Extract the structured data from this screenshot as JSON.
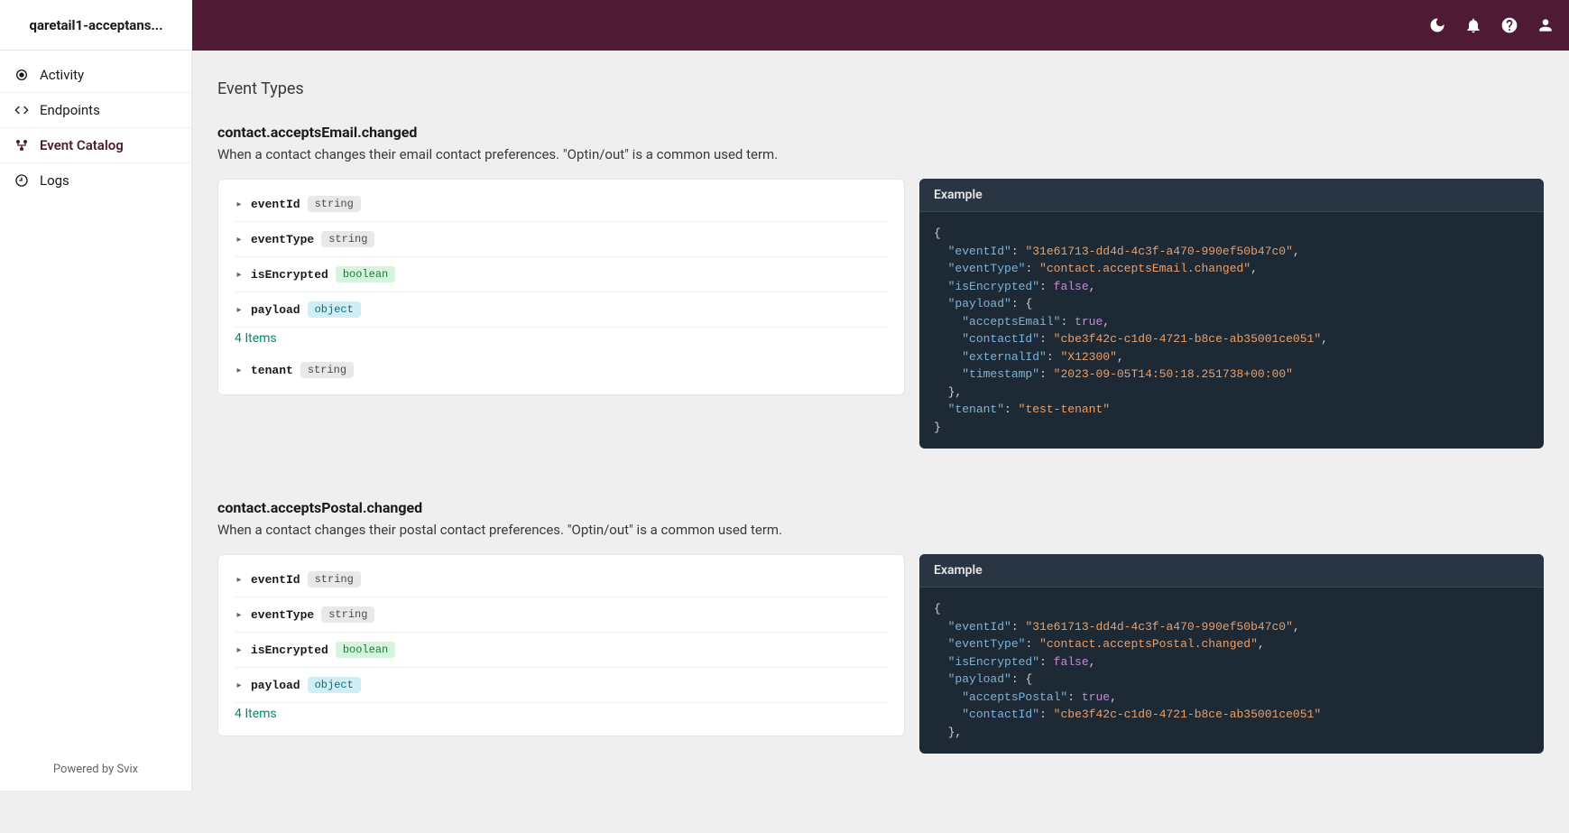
{
  "header": {
    "title": "qaretail1-acceptans..."
  },
  "sidebar": {
    "items": [
      {
        "label": "Activity",
        "icon": "activity-icon",
        "active": false
      },
      {
        "label": "Endpoints",
        "icon": "endpoints-icon",
        "active": false
      },
      {
        "label": "Event Catalog",
        "icon": "catalog-icon",
        "active": true
      },
      {
        "label": "Logs",
        "icon": "logs-icon",
        "active": false
      }
    ],
    "footer": "Powered by Svix"
  },
  "page": {
    "title": "Event Types"
  },
  "events": [
    {
      "name": "contact.acceptsEmail.changed",
      "description": "When a contact changes their email contact preferences. \"Optin/out\" is a common used term.",
      "schema": [
        {
          "name": "eventId",
          "type": "string"
        },
        {
          "name": "eventType",
          "type": "string"
        },
        {
          "name": "isEncrypted",
          "type": "boolean"
        },
        {
          "name": "payload",
          "type": "object"
        }
      ],
      "items_count": "4 Items",
      "schema_tail": [
        {
          "name": "tenant",
          "type": "string"
        }
      ],
      "example_title": "Example",
      "example": {
        "eventId": "31e61713-dd4d-4c3f-a470-990ef50b47c0",
        "eventType": "contact.acceptsEmail.changed",
        "isEncrypted": false,
        "payload": {
          "acceptsEmail": true,
          "contactId": "cbe3f42c-c1d0-4721-b8ce-ab35001ce051",
          "externalId": "X12300",
          "timestamp": "2023-09-05T14:50:18.251738+00:00"
        },
        "tenant": "test-tenant"
      }
    },
    {
      "name": "contact.acceptsPostal.changed",
      "description": "When a contact changes their postal contact preferences. \"Optin/out\" is a common used term.",
      "schema": [
        {
          "name": "eventId",
          "type": "string"
        },
        {
          "name": "eventType",
          "type": "string"
        },
        {
          "name": "isEncrypted",
          "type": "boolean"
        },
        {
          "name": "payload",
          "type": "object"
        }
      ],
      "items_count": "4 Items",
      "schema_tail": [],
      "example_title": "Example",
      "example": {
        "eventId": "31e61713-dd4d-4c3f-a470-990ef50b47c0",
        "eventType": "contact.acceptsPostal.changed",
        "isEncrypted": false,
        "payload": {
          "acceptsPostal": true,
          "contactId": "cbe3f42c-c1d0-4721-b8ce-ab35001ce051"
        }
      },
      "truncated": true
    }
  ]
}
